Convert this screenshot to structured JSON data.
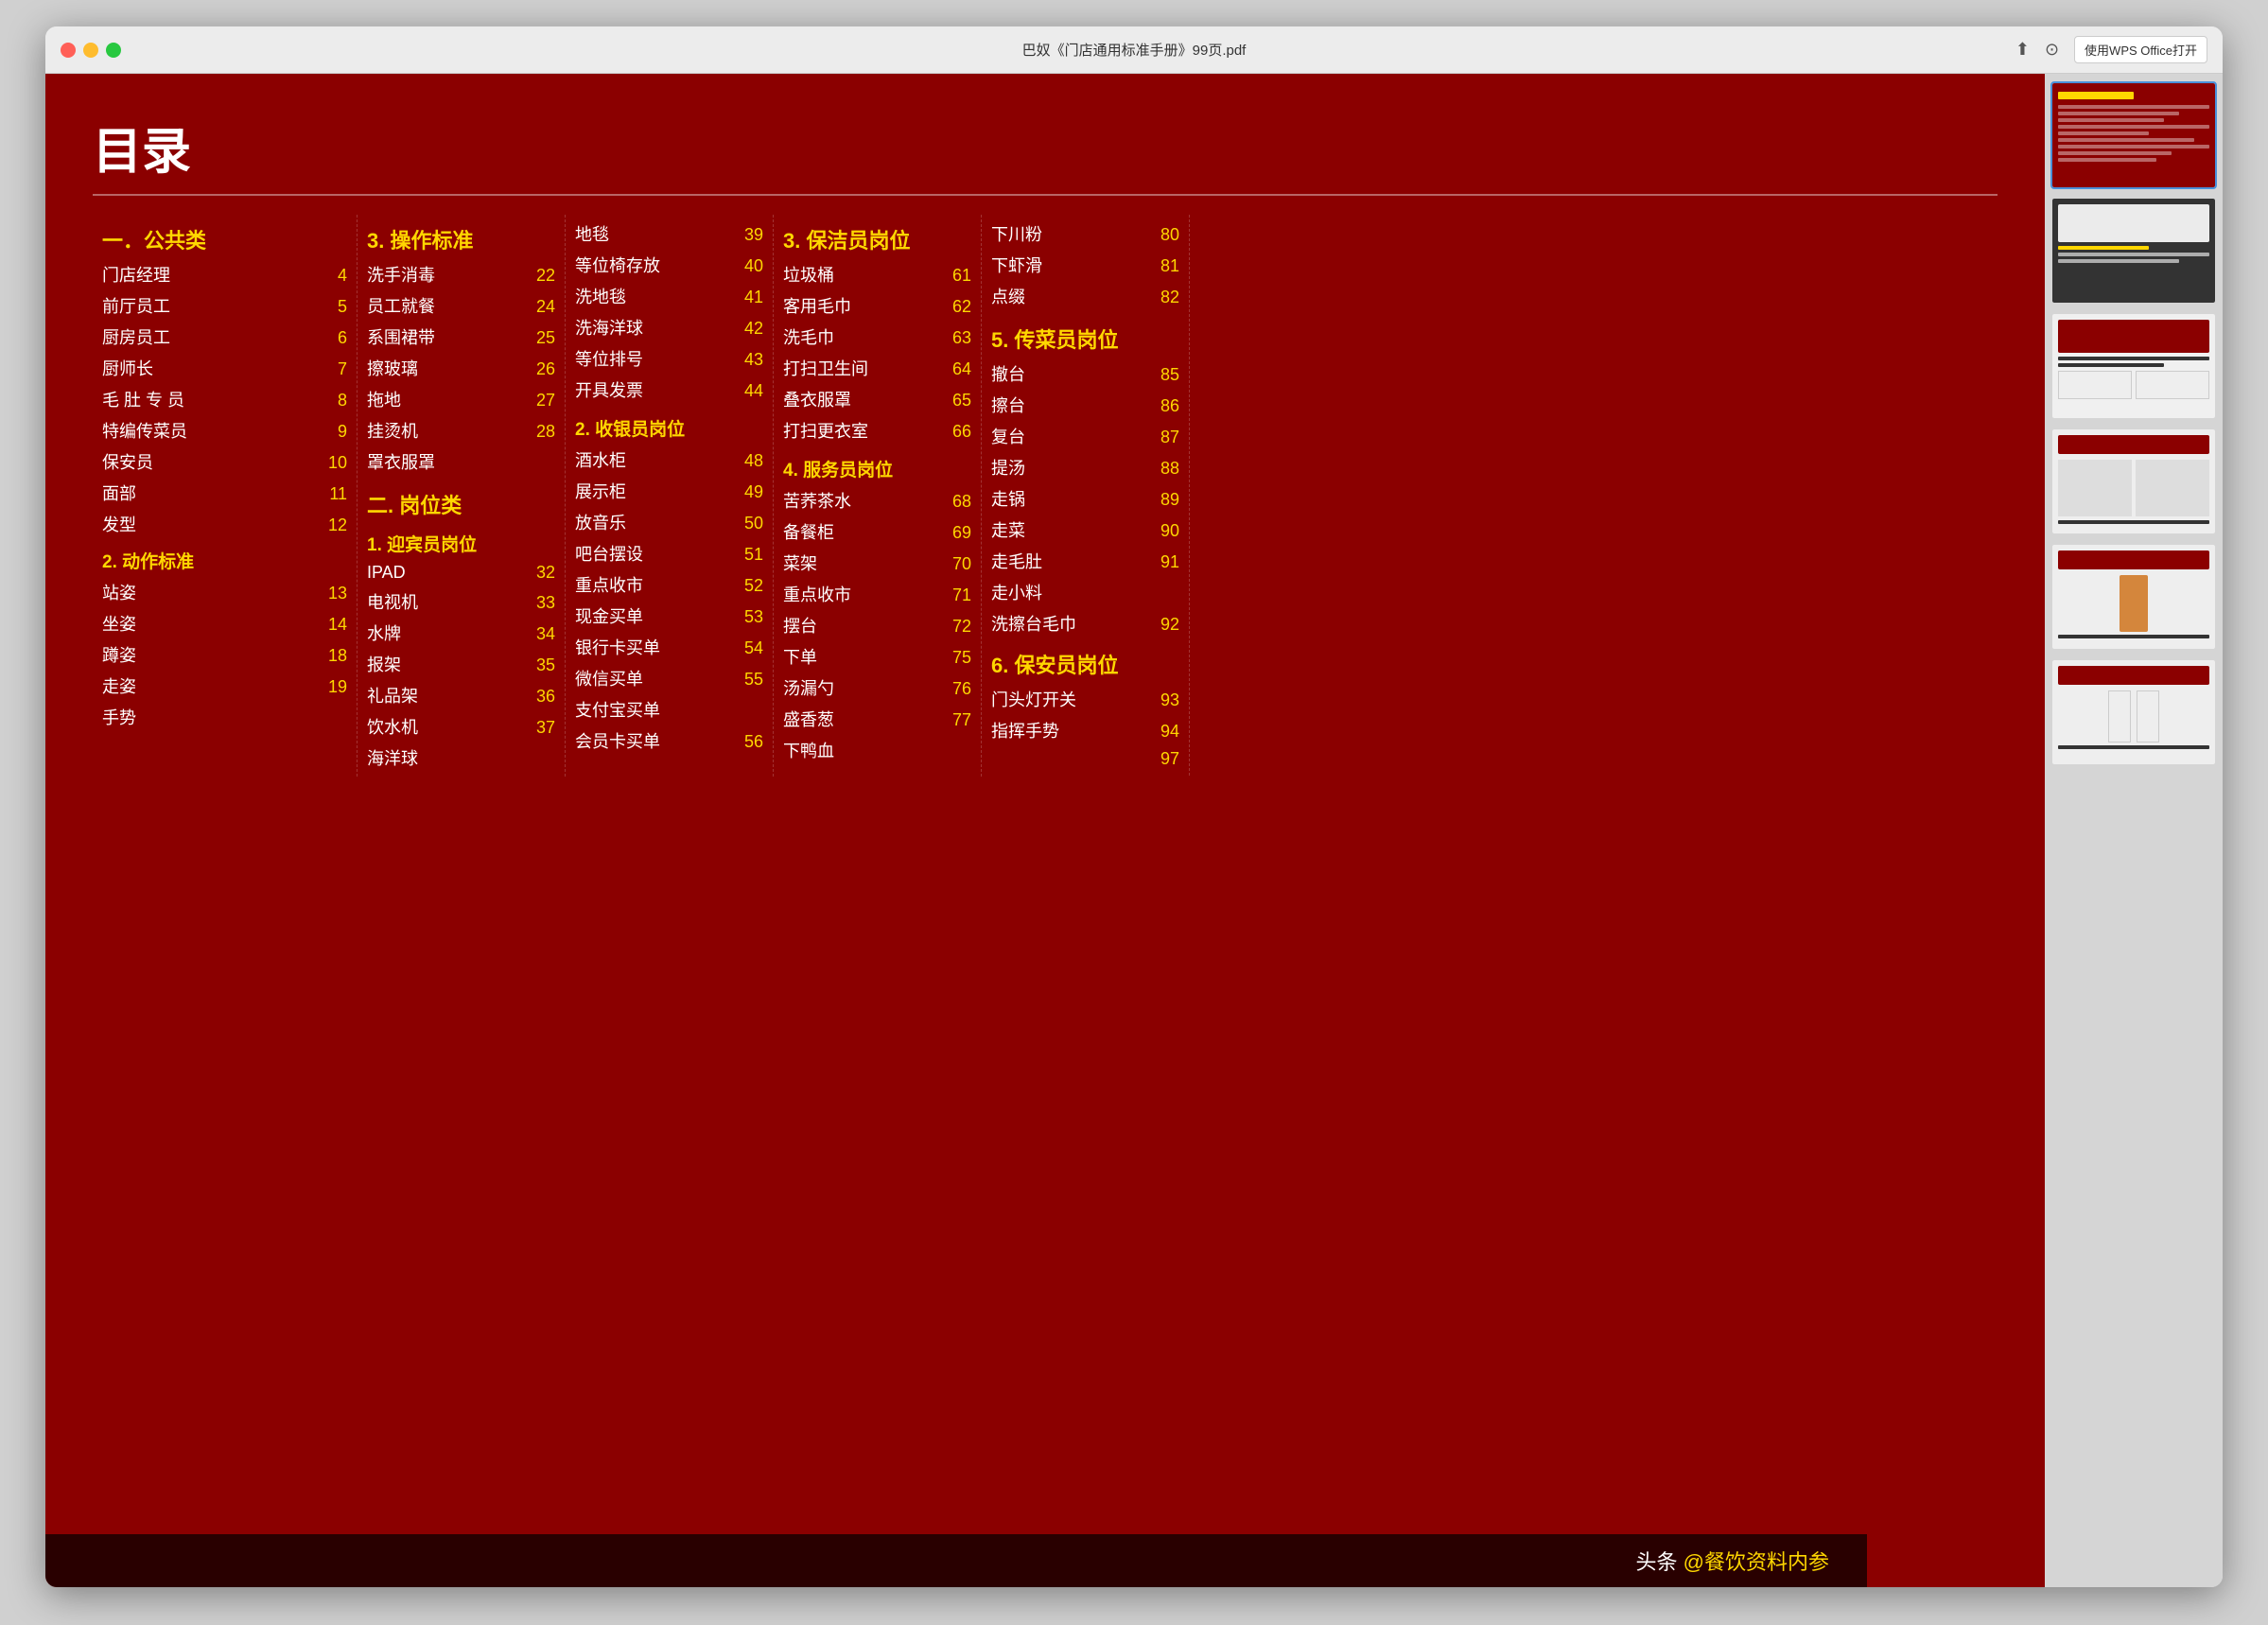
{
  "window": {
    "title": "巴奴《门店通用标准手册》99页.pdf",
    "wps_btn": "使用WPS Office打开"
  },
  "toc": {
    "main_title": "目录",
    "col1": {
      "section": "一．公共类",
      "items": [
        {
          "label": "门店经理",
          "page": "4"
        },
        {
          "label": "前厅员工",
          "page": "5"
        },
        {
          "label": "厨房员工",
          "page": "6"
        },
        {
          "label": "厨师长",
          "page": "7"
        },
        {
          "label": "毛 肚 专 员",
          "page": "8"
        },
        {
          "label": "特编传菜员",
          "page": "9"
        },
        {
          "label": "保安员",
          "page": "10"
        },
        {
          "label": "面部",
          "page": "11"
        },
        {
          "label": "发型",
          "page": "12"
        }
      ],
      "sub_sections": [
        {
          "header": "2. 动作标准",
          "items": [
            {
              "label": "站姿",
              "page": "13"
            },
            {
              "label": "坐姿",
              "page": "14"
            },
            {
              "label": "蹲姿",
              "page": "18"
            },
            {
              "label": "走姿",
              "page": "19"
            },
            {
              "label": "手势",
              "page": ""
            }
          ]
        }
      ]
    },
    "col2": {
      "section": "3. 操作标准",
      "items": [
        {
          "label": "洗手消毒",
          "page": "22"
        },
        {
          "label": "员工就餐",
          "page": "24"
        },
        {
          "label": "系围裙带",
          "page": "25"
        },
        {
          "label": "擦玻璃",
          "page": "26"
        },
        {
          "label": "拖地",
          "page": "27"
        },
        {
          "label": "挂烫机",
          "page": "28"
        },
        {
          "label": "罩衣服罩",
          "page": ""
        }
      ],
      "sub_sections": [
        {
          "header": "二. 岗位类",
          "sub": "1. 迎宾员岗位",
          "items": [
            {
              "label": "IPAD",
              "page": "32"
            },
            {
              "label": "电视机",
              "page": "33"
            },
            {
              "label": "水牌",
              "page": "34"
            },
            {
              "label": "报架",
              "page": "35"
            },
            {
              "label": "礼品架",
              "page": "36"
            },
            {
              "label": "饮水机",
              "page": "37"
            },
            {
              "label": "海洋球",
              "page": ""
            }
          ]
        }
      ]
    },
    "col3": {
      "items": [
        {
          "label": "地毯",
          "page": "39"
        },
        {
          "label": "等位椅存放",
          "page": "40"
        },
        {
          "label": "洗地毯",
          "page": "41"
        },
        {
          "label": "洗海洋球",
          "page": "42"
        },
        {
          "label": "等位排号",
          "page": "43"
        },
        {
          "label": "开具发票",
          "page": "44"
        }
      ],
      "sub_sections": [
        {
          "header": "2. 收银员岗位",
          "items": [
            {
              "label": "酒水柜",
              "page": "48"
            },
            {
              "label": "展示柜",
              "page": "49"
            },
            {
              "label": "放音乐",
              "page": "50"
            },
            {
              "label": "吧台摆设",
              "page": "51"
            },
            {
              "label": "重点收市",
              "page": "52"
            },
            {
              "label": "现金买单",
              "page": "53"
            },
            {
              "label": "银行卡买单",
              "page": "54"
            },
            {
              "label": "微信买单",
              "page": "55"
            },
            {
              "label": "支付宝买单",
              "page": ""
            },
            {
              "label": "会员卡买单",
              "page": "56"
            }
          ]
        }
      ]
    },
    "col4": {
      "section": "3. 保洁员岗位",
      "items": [
        {
          "label": "垃圾桶",
          "page": "61"
        },
        {
          "label": "客用毛巾",
          "page": "62"
        },
        {
          "label": "洗毛巾",
          "page": "63"
        },
        {
          "label": "打扫卫生间",
          "page": "64"
        },
        {
          "label": "叠衣服罩",
          "page": "65"
        },
        {
          "label": "打扫更衣室",
          "page": "66"
        }
      ],
      "sub_sections": [
        {
          "header": "4. 服务员岗位",
          "items": [
            {
              "label": "苦荞茶水",
              "page": "68"
            },
            {
              "label": "备餐柜",
              "page": "69"
            },
            {
              "label": "菜架",
              "page": "70"
            },
            {
              "label": "重点收市",
              "page": "71"
            },
            {
              "label": "摆台",
              "page": "72"
            },
            {
              "label": "下单",
              "page": "75"
            },
            {
              "label": "汤漏勺",
              "page": "76"
            },
            {
              "label": "盛香葱",
              "page": "77"
            },
            {
              "label": "下鸭血",
              "page": ""
            }
          ]
        }
      ]
    },
    "col5": {
      "items": [
        {
          "label": "下川粉",
          "page": "80"
        },
        {
          "label": "下虾滑",
          "page": "81"
        },
        {
          "label": "点缀",
          "page": "82"
        }
      ],
      "sub_sections": [
        {
          "header": "5. 传菜员岗位",
          "items": [
            {
              "label": "撤台",
              "page": "85"
            },
            {
              "label": "擦台",
              "page": "86"
            },
            {
              "label": "复台",
              "page": "87"
            },
            {
              "label": "提汤",
              "page": "88"
            },
            {
              "label": "走锅",
              "page": "89"
            },
            {
              "label": "走菜",
              "page": "90"
            },
            {
              "label": "走毛肚",
              "page": "91"
            },
            {
              "label": "走小料",
              "page": ""
            },
            {
              "label": "洗擦台毛巾",
              "page": "92"
            }
          ]
        },
        {
          "header": "6. 保安员岗位",
          "items": [
            {
              "label": "门头灯开关",
              "page": "93"
            },
            {
              "label": "指挥手势",
              "page": "94"
            },
            {
              "label": "",
              "page": "97"
            }
          ]
        }
      ]
    }
  },
  "footer": {
    "text": "头条 @餐饮资料内参"
  }
}
